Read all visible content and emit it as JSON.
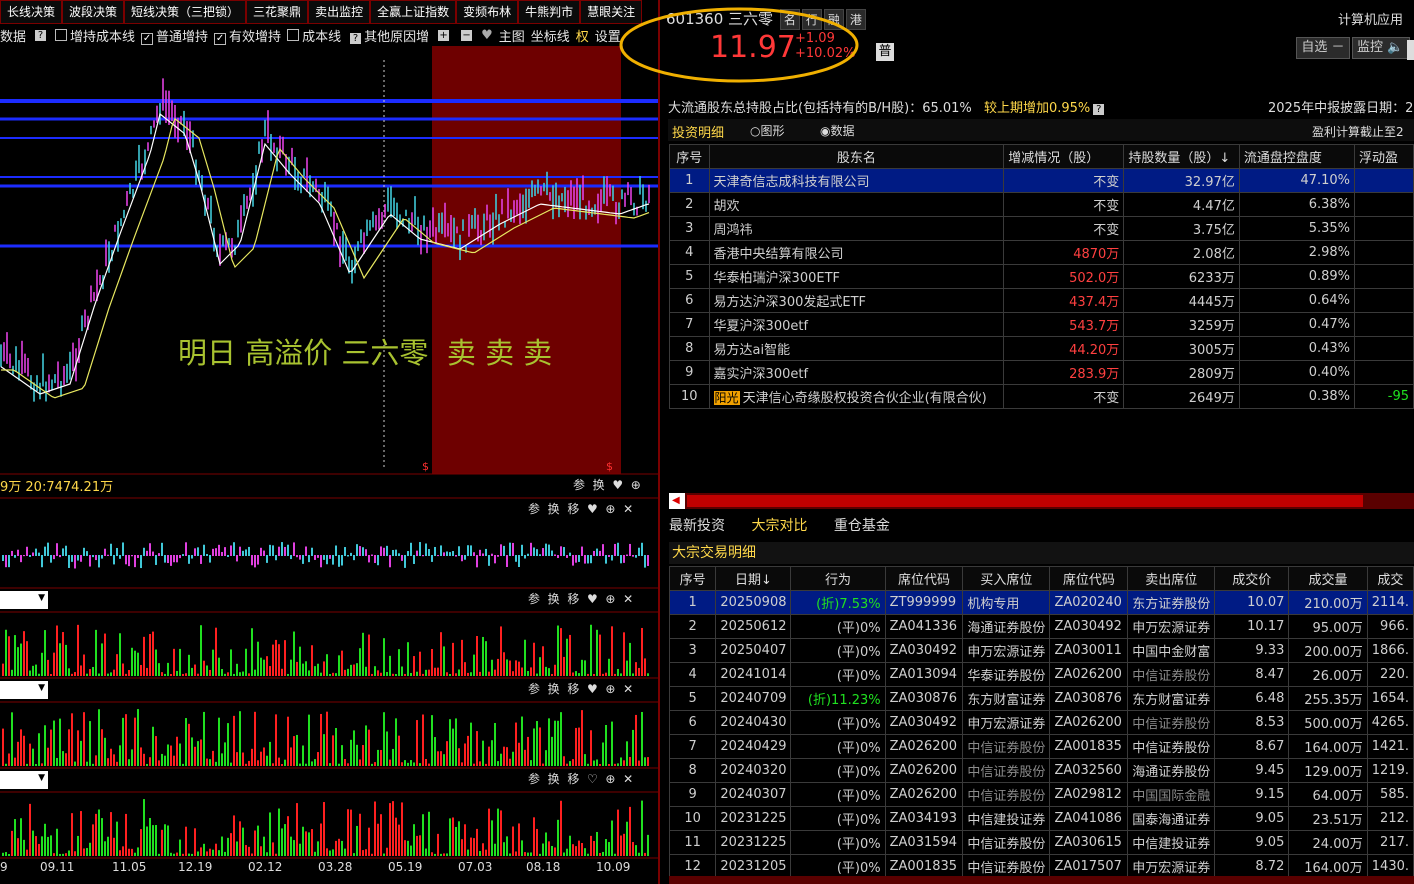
{
  "top_tabs": [
    "长线决策",
    "波段决策",
    "短线决策（三把锁）",
    "三花聚鼎",
    "卖出监控",
    "全赢上证指数",
    "变频布林",
    "牛熊判市",
    "慧眼关注"
  ],
  "chart_toolbar": {
    "data_label": "数据",
    "zengchi_cost": "增持成本线",
    "normal_zengchi": "普通增持",
    "valid_zengchi": "有效增持",
    "cost_line": "成本线",
    "other_reason": "其他原因增",
    "main_chart": "主图",
    "coord_line": "坐标线",
    "quan": "权",
    "settings": "设置"
  },
  "overlay_text": "明日 高溢价 三六零  卖 卖 卖",
  "ma_readout": "9万  20:7474.21万",
  "panel_buttons": [
    "参",
    "换",
    "移"
  ],
  "x_dates": [
    "9",
    "09.11",
    "11.05",
    "12.19",
    "02.12",
    "03.28",
    "05.19",
    "07.03",
    "08.18",
    "10.09"
  ],
  "stock": {
    "code": "601360",
    "name": "三六零",
    "tags": [
      "名",
      "行",
      "融",
      "港"
    ],
    "price": "11.97",
    "change": "+1.09",
    "change_pct": "+10.02%",
    "pu_badge": "普",
    "app_title": "计算机应用",
    "btn_zixuan": "自选 －",
    "btn_jiankong": "监控"
  },
  "holder_summary": {
    "text": "大流通股东总持股占比(包括持有的B/H股)：65.01%",
    "delta": "较上期增加0.95%",
    "disclose": "2025年中报披露日期：2",
    "tab_label": "投资明细",
    "radio_graph": "图形",
    "radio_data": "数据",
    "profit_note": "盈利计算截止至2"
  },
  "holders": {
    "headers": [
      "序号",
      "股东名",
      "增减情况（股）",
      "持股数量（股）↓",
      "流通盘控盘度",
      "浮动盈"
    ],
    "rows": [
      {
        "n": "1",
        "name": "天津奇信志成科技有限公司",
        "chg": "不变",
        "qty": "32.97亿",
        "pct": "47.10%",
        "float": ""
      },
      {
        "n": "2",
        "name": "胡欢",
        "chg": "不变",
        "qty": "4.47亿",
        "pct": "6.38%",
        "float": ""
      },
      {
        "n": "3",
        "name": "周鸿祎",
        "chg": "不变",
        "qty": "3.75亿",
        "pct": "5.35%",
        "float": ""
      },
      {
        "n": "4",
        "name": "香港中央结算有限公司",
        "chg": "4870万",
        "qty": "2.08亿",
        "pct": "2.98%",
        "float": ""
      },
      {
        "n": "5",
        "name": "华泰柏瑞沪深300ETF",
        "chg": "502.0万",
        "qty": "6233万",
        "pct": "0.89%",
        "float": ""
      },
      {
        "n": "6",
        "name": "易方达沪深300发起式ETF",
        "chg": "437.4万",
        "qty": "4445万",
        "pct": "0.64%",
        "float": ""
      },
      {
        "n": "7",
        "name": "华夏沪深300etf",
        "chg": "543.7万",
        "qty": "3259万",
        "pct": "0.47%",
        "float": ""
      },
      {
        "n": "8",
        "name": "易方达ai智能",
        "chg": "44.20万",
        "qty": "3005万",
        "pct": "0.43%",
        "float": ""
      },
      {
        "n": "9",
        "name": "嘉实沪深300etf",
        "chg": "283.9万",
        "qty": "2809万",
        "pct": "0.40%",
        "float": ""
      },
      {
        "n": "10",
        "name": "天津信心奇缘股权投资合伙企业(有限合伙)",
        "badge": "阳光",
        "chg": "不变",
        "qty": "2649万",
        "pct": "0.38%",
        "float": "-95"
      }
    ]
  },
  "lower_tabs": [
    "最新投资",
    "大宗对比",
    "重仓基金"
  ],
  "block_title": "大宗交易明细",
  "block": {
    "headers": [
      "序号",
      "日期↓",
      "行为",
      "席位代码",
      "买入席位",
      "席位代码",
      "卖出席位",
      "成交价",
      "成交量",
      "成交"
    ],
    "rows": [
      {
        "n": "1",
        "date": "20250908",
        "act": "(折)7.53%",
        "c1": "ZT999999",
        "buy": "机构专用",
        "c2": "ZA020240",
        "sell": "东方证券股份",
        "price": "10.07",
        "vol": "210.00万",
        "amt": "2114."
      },
      {
        "n": "2",
        "date": "20250612",
        "act": "(平)0%",
        "c1": "ZA041336",
        "buy": "海通证券股份",
        "c2": "ZA030492",
        "sell": "申万宏源证券",
        "price": "10.17",
        "vol": "95.00万",
        "amt": "966."
      },
      {
        "n": "3",
        "date": "20250407",
        "act": "(平)0%",
        "c1": "ZA030492",
        "buy": "申万宏源证券",
        "c2": "ZA030011",
        "sell": "中国中金财富",
        "price": "9.33",
        "vol": "200.00万",
        "amt": "1866."
      },
      {
        "n": "4",
        "date": "20241014",
        "act": "(平)0%",
        "c1": "ZA013094",
        "buy": "华泰证券股份",
        "c2": "ZA026200",
        "sell": "中信证券股份",
        "price": "8.47",
        "vol": "26.00万",
        "amt": "220."
      },
      {
        "n": "5",
        "date": "20240709",
        "act": "(折)11.23%",
        "c1": "ZA030876",
        "buy": "东方财富证券",
        "c2": "ZA030876",
        "sell": "东方财富证券",
        "price": "6.48",
        "vol": "255.35万",
        "amt": "1654."
      },
      {
        "n": "6",
        "date": "20240430",
        "act": "(平)0%",
        "c1": "ZA030492",
        "buy": "申万宏源证券",
        "c2": "ZA026200",
        "sell": "中信证券股份",
        "price": "8.53",
        "vol": "500.00万",
        "amt": "4265."
      },
      {
        "n": "7",
        "date": "20240429",
        "act": "(平)0%",
        "c1": "ZA026200",
        "buy": "中信证券股份",
        "c2": "ZA001835",
        "sell": "中信证券股份",
        "price": "8.67",
        "vol": "164.00万",
        "amt": "1421."
      },
      {
        "n": "8",
        "date": "20240320",
        "act": "(平)0%",
        "c1": "ZA026200",
        "buy": "中信证券股份",
        "c2": "ZA032560",
        "sell": "海通证券股份",
        "price": "9.45",
        "vol": "129.00万",
        "amt": "1219."
      },
      {
        "n": "9",
        "date": "20240307",
        "act": "(平)0%",
        "c1": "ZA026200",
        "buy": "中信证券股份",
        "c2": "ZA029812",
        "sell": "中国国际金融",
        "price": "9.15",
        "vol": "64.00万",
        "amt": "585."
      },
      {
        "n": "10",
        "date": "20231225",
        "act": "(平)0%",
        "c1": "ZA034193",
        "buy": "中信建投证券",
        "c2": "ZA041086",
        "sell": "国泰海通证券",
        "price": "9.05",
        "vol": "23.51万",
        "amt": "212."
      },
      {
        "n": "11",
        "date": "20231225",
        "act": "(平)0%",
        "c1": "ZA031594",
        "buy": "中信证券股份",
        "c2": "ZA030615",
        "sell": "中信建投证券",
        "price": "9.05",
        "vol": "24.00万",
        "amt": "217."
      },
      {
        "n": "12",
        "date": "20231205",
        "act": "(平)0%",
        "c1": "ZA001835",
        "buy": "中信证券股份",
        "c2": "ZA017507",
        "sell": "申万宏源证券",
        "price": "8.72",
        "vol": "164.00万",
        "amt": "1430."
      }
    ]
  },
  "colors": {
    "up": "#ff4040",
    "down": "#20e020",
    "select": "#001b84",
    "frame": "#7a0000",
    "overlay": "#a8c230"
  }
}
